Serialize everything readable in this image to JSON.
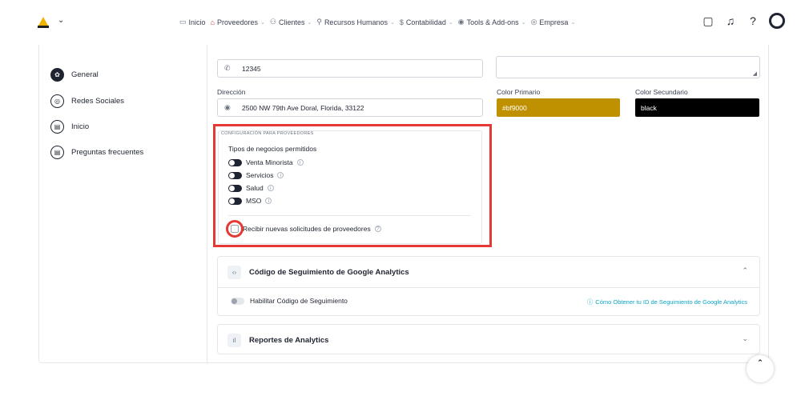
{
  "nav": {
    "items": [
      {
        "icon": "monitor-icon",
        "glyph": "▭",
        "label": "Inicio",
        "caret": ""
      },
      {
        "icon": "store-icon",
        "glyph": "⌂",
        "label": "Proveedores",
        "caret": "⌄"
      },
      {
        "icon": "users-icon",
        "glyph": "⚇",
        "label": "Clientes",
        "caret": "⌄"
      },
      {
        "icon": "hr-icon",
        "glyph": "⚲",
        "label": "Recursos Humanos",
        "caret": "⌄"
      },
      {
        "icon": "dollar-icon",
        "glyph": "$",
        "label": "Contabilidad",
        "caret": "⌄"
      },
      {
        "icon": "tools-icon",
        "glyph": "◉",
        "label": "Tools & Add-ons",
        "caret": "⌄"
      },
      {
        "icon": "building-icon",
        "glyph": "◎",
        "label": "Empresa",
        "caret": "⌄"
      }
    ]
  },
  "sidebar": {
    "items": [
      {
        "label": "General",
        "icon": "gear-icon",
        "glyph": "✿",
        "active": true
      },
      {
        "label": "Redes Sociales",
        "icon": "instagram-icon",
        "glyph": "◎",
        "active": false
      },
      {
        "label": "Inicio",
        "icon": "document-icon",
        "glyph": "▤",
        "active": false
      },
      {
        "label": "Preguntas frecuentes",
        "icon": "faq-document-icon",
        "glyph": "▤",
        "active": false
      }
    ]
  },
  "form": {
    "phone_value": "12345",
    "address_label": "Dirección",
    "address_value": "2500 NW 79th Ave Doral, Florida, 33122",
    "primary_color_label": "Color Primario",
    "primary_color_value": "#bf9000",
    "secondary_color_label": "Color Secundario",
    "secondary_color_value": "black"
  },
  "providers": {
    "section_title": "CONFIGURACIÓN PARA PROVEEDORES",
    "subtitle": "Tipos de negocios permitidos",
    "types": [
      {
        "label": "Venta Minorista",
        "enabled": true
      },
      {
        "label": "Servicios",
        "enabled": true
      },
      {
        "label": "Salud",
        "enabled": true
      },
      {
        "label": "MSO",
        "enabled": true
      }
    ],
    "receive_label": "Recibir nuevas solicitudes de proveedores",
    "receive_checked": false
  },
  "analytics": {
    "title": "Código de Seguimiento de Google Analytics",
    "toggle_label": "Habilitar Código de Seguimiento",
    "toggle_enabled": false,
    "help_link": "Cómo Obtener tu ID de Seguimiento de Google Analytics"
  },
  "reports": {
    "title": "Reportes de Analytics"
  },
  "colors": {
    "primary": "#bf9000",
    "secondary": "#000000",
    "highlight": "#e53935",
    "link": "#0ea5c6"
  }
}
